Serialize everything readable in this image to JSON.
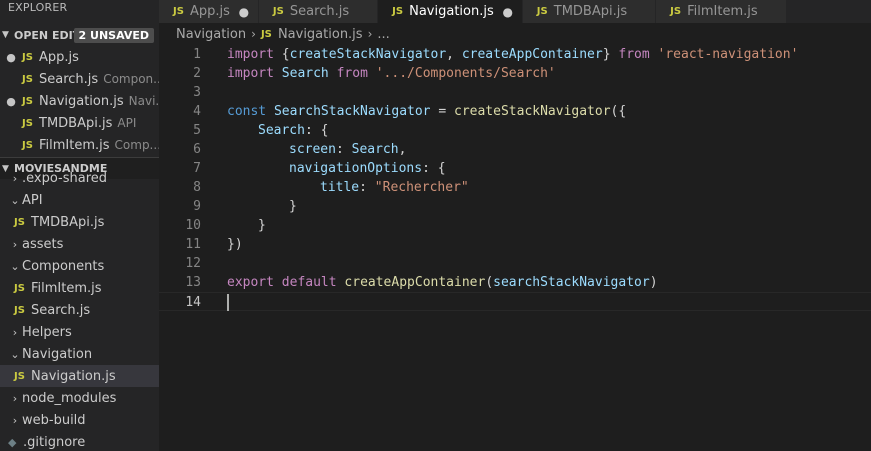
{
  "sidebar": {
    "explorer_title": "EXPLORER",
    "open_editors": {
      "title": "OPEN EDITO...",
      "badge": "2 UNSAVED",
      "items": [
        {
          "name": "App.js",
          "desc": "",
          "unsaved": true
        },
        {
          "name": "Search.js",
          "desc": "Compon...",
          "unsaved": false
        },
        {
          "name": "Navigation.js",
          "desc": "Navi...",
          "unsaved": true
        },
        {
          "name": "TMDBApi.js",
          "desc": "API",
          "unsaved": false
        },
        {
          "name": "FilmItem.js",
          "desc": "Comp...",
          "unsaved": false
        }
      ]
    },
    "project": {
      "title": "MOVIESANDME",
      "items": [
        {
          "label": ".expo-shared",
          "type": "folder",
          "expanded": false
        },
        {
          "label": "API",
          "type": "folder",
          "expanded": true
        },
        {
          "label": "TMDBApi.js",
          "type": "file"
        },
        {
          "label": "assets",
          "type": "folder",
          "expanded": false
        },
        {
          "label": "Components",
          "type": "folder",
          "expanded": true
        },
        {
          "label": "FilmItem.js",
          "type": "file"
        },
        {
          "label": "Search.js",
          "type": "file"
        },
        {
          "label": "Helpers",
          "type": "folder",
          "expanded": false
        },
        {
          "label": "Navigation",
          "type": "folder",
          "expanded": true
        },
        {
          "label": "Navigation.js",
          "type": "file",
          "selected": true
        },
        {
          "label": "node_modules",
          "type": "folder",
          "expanded": false
        },
        {
          "label": "web-build",
          "type": "folder",
          "expanded": false
        },
        {
          "label": ".gitignore",
          "type": "gitignore"
        }
      ]
    }
  },
  "tabs": [
    {
      "label": "App.js",
      "unsaved": true,
      "active": false
    },
    {
      "label": "Search.js",
      "unsaved": false,
      "active": false
    },
    {
      "label": "Navigation.js",
      "unsaved": true,
      "active": true
    },
    {
      "label": "TMDBApi.js",
      "unsaved": false,
      "active": false
    },
    {
      "label": "FilmItem.js",
      "unsaved": false,
      "active": false
    }
  ],
  "breadcrumb": {
    "folder": "Navigation",
    "file": "Navigation.js",
    "trail": "..."
  },
  "icons": {
    "js": "JS",
    "dot": "●",
    "chevron_right": "›",
    "chevron_down": "⌄",
    "gitignore": "◆"
  },
  "colors": {
    "keyword": "#c586c0",
    "storage": "#569cd6",
    "function": "#dcdcaa",
    "variable": "#9cdcfe",
    "string": "#ce9178",
    "js_icon": "#cbcb41"
  },
  "editor": {
    "lines": [
      {
        "n": "1",
        "t": "import {createStackNavigator, createAppContainer} from 'react-navigation'"
      },
      {
        "n": "2",
        "t": "import Search from '.../Components/Search'"
      },
      {
        "n": "3",
        "t": ""
      },
      {
        "n": "4",
        "t": "const SearchStackNavigator = createStackNavigator({"
      },
      {
        "n": "5",
        "t": "    Search: {"
      },
      {
        "n": "6",
        "t": "        screen: Search,"
      },
      {
        "n": "7",
        "t": "        navigationOptions: {"
      },
      {
        "n": "8",
        "t": "            title: \"Rechercher\""
      },
      {
        "n": "9",
        "t": "        }"
      },
      {
        "n": "10",
        "t": "    }"
      },
      {
        "n": "11",
        "t": "})"
      },
      {
        "n": "12",
        "t": ""
      },
      {
        "n": "13",
        "t": "export default createAppContainer(searchStackNavigator)"
      },
      {
        "n": "14",
        "t": ""
      }
    ]
  }
}
